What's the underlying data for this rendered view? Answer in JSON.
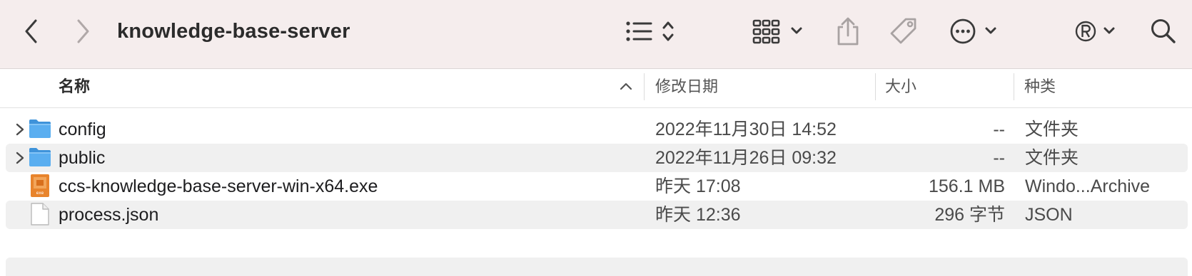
{
  "window": {
    "title": "knowledge-base-server"
  },
  "toolbar": {
    "back_icon": "chevron-left-icon",
    "forward_icon": "chevron-right-icon",
    "list_view_icon": "list-icon",
    "group_icon": "icon-grid-icon",
    "share_icon": "share-icon",
    "tag_icon": "tag-icon",
    "action_icon": "ellipsis-circle-icon",
    "extension_icon": "registered-icon",
    "search_icon": "magnifier-icon"
  },
  "columns": {
    "name": "名称",
    "modified": "修改日期",
    "size": "大小",
    "kind": "种类"
  },
  "files": [
    {
      "name": "config",
      "modified": "2022年11月30日 14:52",
      "size": "--",
      "kind": "文件夹",
      "icon": "folder-icon",
      "expandable": true
    },
    {
      "name": "public",
      "modified": "2022年11月26日 09:32",
      "size": "--",
      "kind": "文件夹",
      "icon": "folder-icon",
      "expandable": true
    },
    {
      "name": "ccs-knowledge-base-server-win-x64.exe",
      "modified": "昨天 17:08",
      "size": "156.1 MB",
      "kind": "Windo...Archive",
      "icon": "exe-file-icon",
      "expandable": false
    },
    {
      "name": "process.json",
      "modified": "昨天 12:36",
      "size": "296 字节",
      "kind": "JSON",
      "icon": "document-icon",
      "expandable": false
    }
  ],
  "colors": {
    "toolbar_bg": "#f5eded",
    "folder_blue": "#5aaef0",
    "exe_orange": "#e8842c",
    "alt_row": "#f0f0f0"
  }
}
